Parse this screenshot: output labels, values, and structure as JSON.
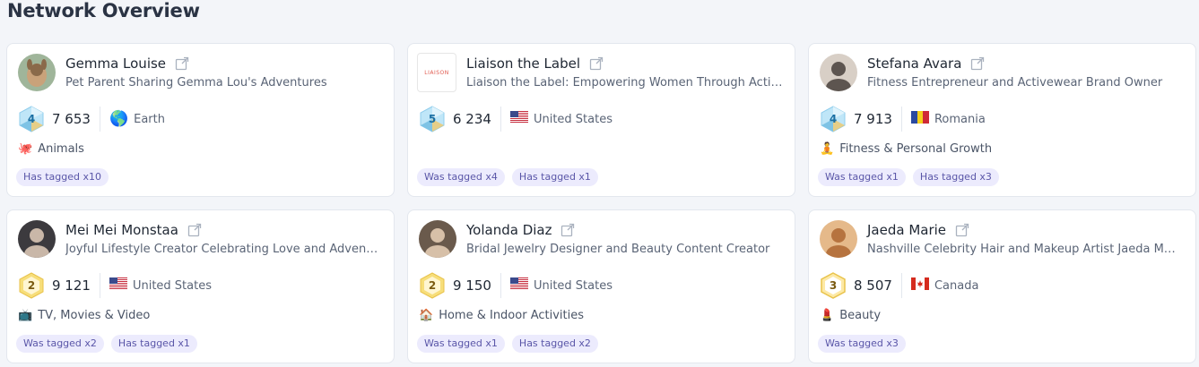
{
  "page": {
    "title": "Network Overview"
  },
  "colors": {
    "background": "#f3f5f9",
    "card": "#ffffff",
    "tag_bg": "#ecebfd",
    "tag_text": "#5a56a8",
    "badge_diamond": "#9fd9f5",
    "badge_gold": "#f3d35a"
  },
  "cards": [
    {
      "name": "Gemma Louise",
      "bio": "Pet Parent Sharing Gemma Lou's Adventures",
      "avatar": "photo-dog",
      "level": "4",
      "level_style": "diamond",
      "followers": "7 653",
      "country": "Earth",
      "country_icon": "globe-icon",
      "category": "Animals",
      "category_icon": "octopus-icon",
      "tags": [
        "Has tagged x10"
      ]
    },
    {
      "name": "Liaison the Label",
      "bio": "Liaison the Label: Empowering Women Through Acti…",
      "avatar": "logo",
      "logo_text": "LIAISON",
      "level": "5",
      "level_style": "diamond",
      "followers": "6 234",
      "country": "United States",
      "country_icon": "flag-us-icon",
      "category": "",
      "category_icon": "",
      "tags": [
        "Was tagged x4",
        "Has tagged x1"
      ]
    },
    {
      "name": "Stefana Avara",
      "bio": "Fitness Entrepreneur and Activewear Brand Owner",
      "avatar": "photo-woman",
      "level": "4",
      "level_style": "diamond",
      "followers": "7 913",
      "country": "Romania",
      "country_icon": "flag-ro-icon",
      "category": "Fitness & Personal Growth",
      "category_icon": "yoga-icon",
      "tags": [
        "Was tagged x1",
        "Has tagged x3"
      ]
    },
    {
      "name": "Mei Mei Monstaa",
      "bio": "Joyful Lifestyle Creator Celebrating Love and Adven…",
      "avatar": "photo-woman",
      "level": "2",
      "level_style": "gold",
      "followers": "9 121",
      "country": "United States",
      "country_icon": "flag-us-icon",
      "category": "TV, Movies & Video",
      "category_icon": "tv-icon",
      "tags": [
        "Was tagged x2",
        "Has tagged x1"
      ]
    },
    {
      "name": "Yolanda Diaz",
      "bio": "Bridal Jewelry Designer and Beauty Content Creator",
      "avatar": "photo-woman",
      "level": "2",
      "level_style": "gold",
      "followers": "9 150",
      "country": "United States",
      "country_icon": "flag-us-icon",
      "category": "Home & Indoor Activities",
      "category_icon": "house-icon",
      "tags": [
        "Was tagged x1",
        "Has tagged x2"
      ]
    },
    {
      "name": "Jaeda Marie",
      "bio": "Nashville Celebrity Hair and Makeup Artist Jaeda M…",
      "avatar": "photo-woman",
      "level": "3",
      "level_style": "gold-outline",
      "followers": "8 507",
      "country": "Canada",
      "country_icon": "flag-ca-icon",
      "category": "Beauty",
      "category_icon": "lipstick-icon",
      "tags": [
        "Was tagged x3"
      ]
    }
  ]
}
